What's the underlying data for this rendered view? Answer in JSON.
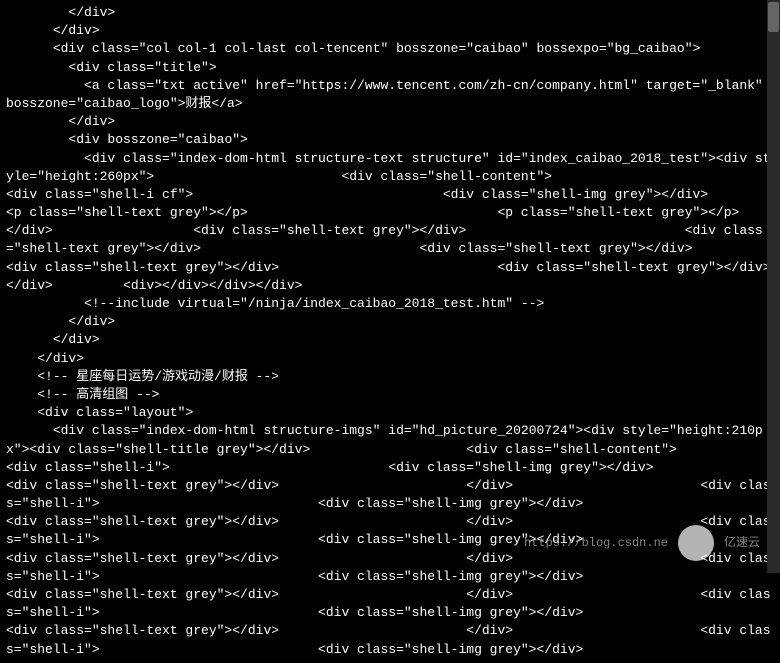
{
  "lines": [
    "        </div>",
    "      </div>",
    "      <div class=\"col col-1 col-last col-tencent\" bosszone=\"caibao\" bossexpo=\"bg_caibao\">",
    "        <div class=\"title\">",
    "          <a class=\"txt active\" href=\"https://www.tencent.com/zh-cn/company.html\" target=\"_blank\" bosszone=\"caibao_logo\">财报</a>",
    "        </div>",
    "        <div bosszone=\"caibao\">",
    "          <div class=\"index-dom-html structure-text structure\" id=\"index_caibao_2018_test\"><div style=\"height:260px\">                        <div class=\"shell-content\">                            <div class=\"shell-i cf\">                                <div class=\"shell-img grey\"></div>                                <p class=\"shell-text grey\"></p>                                <p class=\"shell-text grey\"></p>                            </div>                  <div class=\"shell-text grey\"></div>                            <div class=\"shell-text grey\"></div>                            <div class=\"shell-text grey\"></div>                            <div class=\"shell-text grey\"></div>                            <div class=\"shell-text grey\"></div>                        </div>         <div></div></div></div>",
    "          <!--include virtual=\"/ninja/index_caibao_2018_test.htm\" -->",
    "        </div>",
    "      </div>",
    "    </div>",
    "    <!-- 星座每日运势/游戏动漫/财报 -->",
    "",
    "    <!-- 高清组图 -->",
    "    <div class=\"layout\">",
    "      <div class=\"index-dom-html structure-imgs\" id=\"hd_picture_20200724\"><div style=\"height:210px\"><div class=\"shell-title grey\"></div>                    <div class=\"shell-content\">                        <div class=\"shell-i\">                            <div class=\"shell-img grey\"></div>                            <div class=\"shell-text grey\"></div>                        </div>                        <div class=\"shell-i\">                            <div class=\"shell-img grey\"></div>                            <div class=\"shell-text grey\"></div>                        </div>                        <div class=\"shell-i\">                            <div class=\"shell-img grey\"></div>                            <div class=\"shell-text grey\"></div>                        </div>                        <div class=\"shell-i\">                            <div class=\"shell-img grey\"></div>                            <div class=\"shell-text grey\"></div>                        </div>                        <div class=\"shell-i\">                            <div class=\"shell-img grey\"></div>                            <div class=\"shell-text grey\"></div>                        </div>                        <div class=\"shell-i\">                            <div class=\"shell-img grey\"></div>"
  ],
  "watermark": {
    "url": "https://blog.csdn.ne",
    "brand": "亿速云"
  }
}
